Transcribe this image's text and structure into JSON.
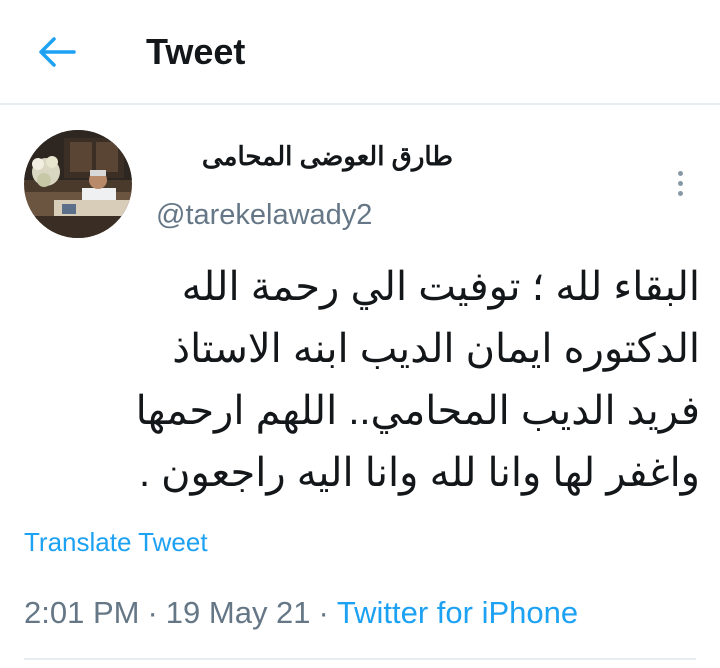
{
  "header": {
    "title": "Tweet",
    "back_icon": "arrow-left-icon",
    "accent": "#1da1f2"
  },
  "tweet": {
    "author_name": "طارق العوضى المحامى",
    "handle": "@tarekelawady2",
    "lines": [
      "البقاء لله ؛ توفيت الي رحمة الله",
      "الدكتوره ايمان الديب ابنه الاستاذ",
      "فريد الديب المحامي.. اللهم ارحمها",
      "واغفر لها وانا لله وانا اليه راجعون ."
    ],
    "translate_label": "Translate Tweet",
    "time": "2:01 PM",
    "date": "19 May 21",
    "separator": "·",
    "source": "Twitter for iPhone"
  },
  "icons": {
    "more": "more-vertical-icon",
    "avatar": "avatar"
  }
}
